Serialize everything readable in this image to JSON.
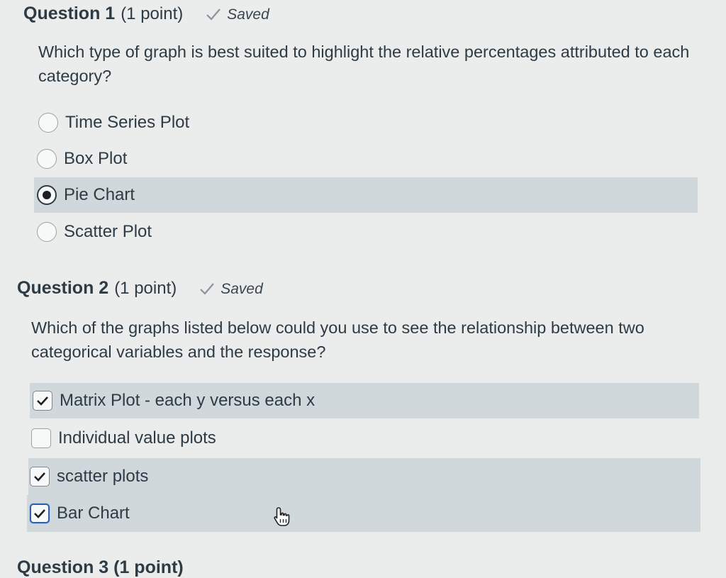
{
  "question1": {
    "title": "Question 1",
    "points": "(1 point)",
    "saved_label": "Saved",
    "text": "Which type of graph is best suited to highlight the relative percentages attributed to each category?",
    "options": [
      {
        "label": "Time Series Plot",
        "selected": false
      },
      {
        "label": "Box Plot",
        "selected": false
      },
      {
        "label": "Pie Chart",
        "selected": true
      },
      {
        "label": "Scatter Plot",
        "selected": false
      }
    ]
  },
  "question2": {
    "title": "Question 2",
    "points": "(1 point)",
    "saved_label": "Saved",
    "text": "Which of the graphs listed below could you use to see the relationship between two categorical variables and the response?",
    "options": [
      {
        "label": "Matrix Plot - each y versus each x",
        "checked": true
      },
      {
        "label": "Individual value plots",
        "checked": false
      },
      {
        "label": "scatter plots",
        "checked": true
      },
      {
        "label": "Bar Chart",
        "checked": true,
        "focused": true
      }
    ]
  },
  "question3_peek": "Question 3 (1 point)",
  "icons": {
    "saved": "checkmark-icon",
    "cursor": "hand-pointer-icon"
  },
  "colors": {
    "background": "#ebecec",
    "selected_row": "#d0d8dc",
    "text": "#2d3b45",
    "focus_outline": "#2b5fa8"
  }
}
